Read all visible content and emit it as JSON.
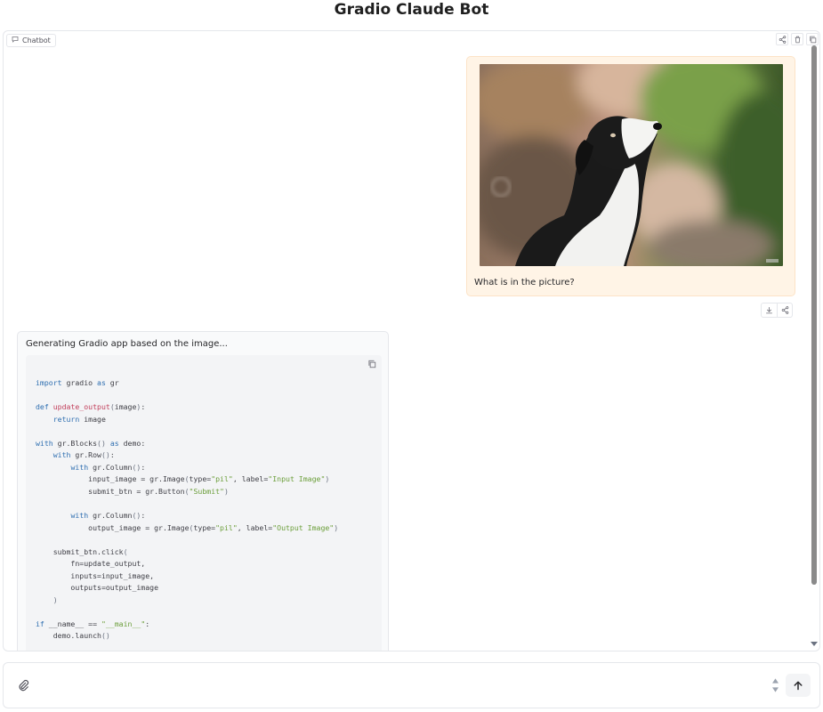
{
  "app": {
    "title": "Gradio Claude Bot"
  },
  "chatbot": {
    "label": "Chatbot",
    "label_icon": "chat-bubble-icon",
    "actions": [
      "share-icon",
      "trash-icon",
      "copy-icon"
    ]
  },
  "messages": [
    {
      "role": "user",
      "image_icon": "dog-photo",
      "text": "What is in the picture?",
      "actions": [
        "download-icon",
        "share-icon"
      ]
    },
    {
      "role": "assistant",
      "text": "Generating Gradio app based on the image...",
      "code_language": "python",
      "code": "import gradio as gr\n\ndef update_output(image):\n    return image\n\nwith gr.Blocks() as demo:\n    with gr.Row():\n        with gr.Column():\n            input_image = gr.Image(type=\"pil\", label=\"Input Image\")\n            submit_btn = gr.Button(\"Submit\")\n\n        with gr.Column():\n            output_image = gr.Image(type=\"pil\", label=\"Output Image\")\n\n    submit_btn.click(\n        fn=update_output,\n        inputs=input_image,\n        outputs=output_image\n    )\n\nif __name__ == \"__main__\":\n    demo.launch()"
    }
  ],
  "input": {
    "value": "",
    "placeholder": "",
    "attach_icon": "paperclip-icon",
    "submit_icon": "arrow-up-icon"
  },
  "colors": {
    "user_bubble": "#fff4e6",
    "bot_bubble": "#f9fafb",
    "code_bg": "#f3f4f6",
    "keyword": "#2f6fb1",
    "function_name": "#c2405c",
    "string": "#6b9e3a"
  }
}
